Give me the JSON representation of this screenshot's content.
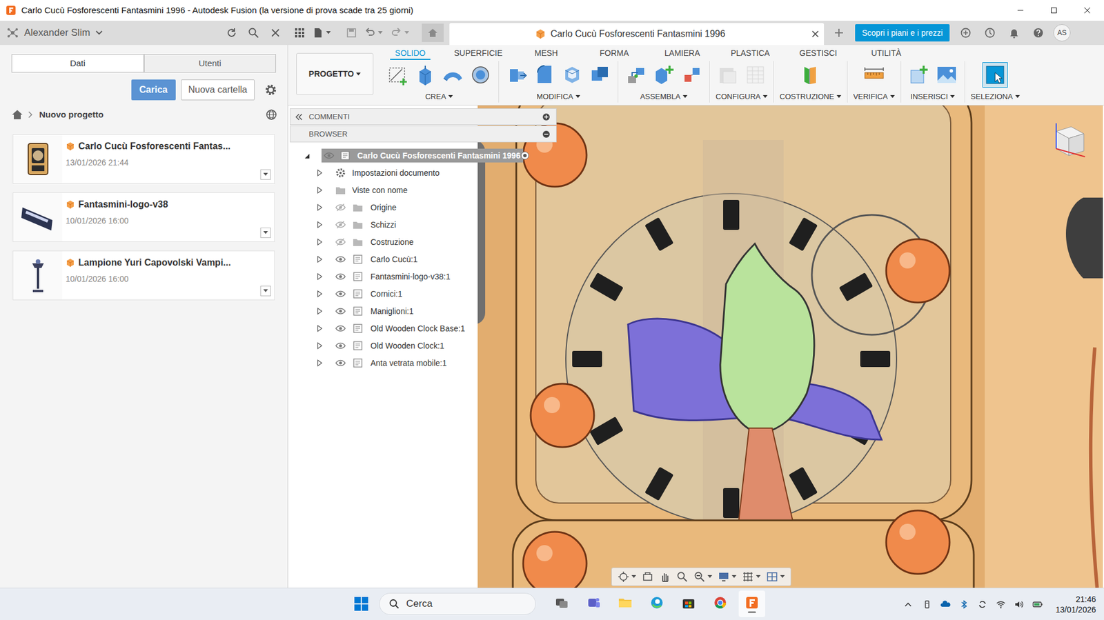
{
  "window": {
    "title": "Carlo Cucù Fosforescenti Fantasmini 1996 - Autodesk Fusion (la versione di prova scade tra 25 giorni)"
  },
  "account": {
    "name": "Alexander Slim",
    "initials": "AS"
  },
  "document_tab": {
    "label": "Carlo Cucù Fosforescenti Fantasmini 1996"
  },
  "promo_button": "Scopri i piani e i prezzi",
  "data_panel": {
    "tabs": [
      {
        "label": "Dati",
        "selected": true
      },
      {
        "label": "Utenti",
        "selected": false
      }
    ],
    "upload_button": "Carica",
    "new_folder_button": "Nuova cartella",
    "breadcrumb": "Nuovo progetto",
    "files": [
      {
        "name": "Carlo Cucù Fosforescenti Fantas...",
        "date": "13/01/2026 21:44",
        "kind": "clock"
      },
      {
        "name": "Fantasmini-logo-v38",
        "date": "10/01/2026 16:00",
        "kind": "logo"
      },
      {
        "name": "Lampione Yuri Capovolski Vampi...",
        "date": "10/01/2026 16:00",
        "kind": "lamp"
      }
    ]
  },
  "toolbar": {
    "workspace": "PROGETTO",
    "tabs": [
      {
        "label": "SOLIDO",
        "selected": true
      },
      {
        "label": "SUPERFICIE",
        "selected": false
      },
      {
        "label": "MESH",
        "selected": false
      },
      {
        "label": "FORMA",
        "selected": false
      },
      {
        "label": "LAMIERA",
        "selected": false
      },
      {
        "label": "PLASTICA",
        "selected": false
      },
      {
        "label": "GESTISCI",
        "selected": false
      },
      {
        "label": "UTILITÀ",
        "selected": false
      }
    ],
    "groups": [
      {
        "label": "CREA",
        "tools": [
          "sketch",
          "extrude",
          "sweep",
          "hole"
        ],
        "disabled": false,
        "active": false
      },
      {
        "label": "MODIFICA",
        "tools": [
          "press-pull",
          "fillet",
          "shell",
          "combine"
        ],
        "disabled": false,
        "active": false
      },
      {
        "label": "ASSEMBLA",
        "tools": [
          "joint",
          "new-component",
          "rigid-group"
        ],
        "disabled": false,
        "active": false
      },
      {
        "label": "CONFIGURA",
        "tools": [
          "configure",
          "table"
        ],
        "disabled": true,
        "active": false
      },
      {
        "label": "COSTRUZIONE",
        "tools": [
          "plane"
        ],
        "disabled": false,
        "active": false
      },
      {
        "label": "VERIFICA",
        "tools": [
          "measure"
        ],
        "disabled": false,
        "active": false
      },
      {
        "label": "INSERISCI",
        "tools": [
          "insert-component",
          "canvas"
        ],
        "disabled": false,
        "active": false
      },
      {
        "label": "SELEZIONA",
        "tools": [
          "select"
        ],
        "disabled": false,
        "active": true
      }
    ]
  },
  "browser": {
    "comments": "COMMENTI",
    "title": "BROWSER",
    "root": {
      "label": "Carlo Cucù Fosforescenti Fantasmini 1996",
      "selected": true,
      "expanded": true,
      "visible": true
    },
    "items": [
      {
        "label": "Impostazioni documento",
        "kind": "settings",
        "expanded": false
      },
      {
        "label": "Viste con nome",
        "kind": "views",
        "expanded": false
      },
      {
        "label": "Origine",
        "kind": "folder",
        "visible": false,
        "expanded": false
      },
      {
        "label": "Schizzi",
        "kind": "folder",
        "visible": false,
        "expanded": false
      },
      {
        "label": "Costruzione",
        "kind": "folder",
        "visible": false,
        "expanded": false
      },
      {
        "label": "Carlo Cucù:1",
        "kind": "component",
        "visible": true,
        "expanded": false
      },
      {
        "label": "Fantasmini-logo-v38:1",
        "kind": "component",
        "visible": true,
        "expanded": false
      },
      {
        "label": "Cornici:1",
        "kind": "component",
        "visible": true,
        "expanded": false
      },
      {
        "label": "Maniglioni:1",
        "kind": "component",
        "visible": true,
        "expanded": false
      },
      {
        "label": "Old Wooden Clock Base:1",
        "kind": "component",
        "visible": true,
        "expanded": false
      },
      {
        "label": "Old Wooden Clock:1",
        "kind": "component",
        "visible": true,
        "expanded": false
      },
      {
        "label": "Anta vetrata mobile:1",
        "kind": "component",
        "visible": true,
        "expanded": false
      }
    ]
  },
  "taskbar": {
    "search": "Cerca",
    "apps": [
      {
        "kind": "task-view",
        "selected": false
      },
      {
        "kind": "teams",
        "selected": false
      },
      {
        "kind": "explorer",
        "selected": false
      },
      {
        "kind": "edge",
        "selected": false
      },
      {
        "kind": "store",
        "selected": false
      },
      {
        "kind": "chrome",
        "selected": false
      },
      {
        "kind": "fusion",
        "selected": true
      }
    ],
    "time": "21:46",
    "date": "13/01/2026"
  }
}
